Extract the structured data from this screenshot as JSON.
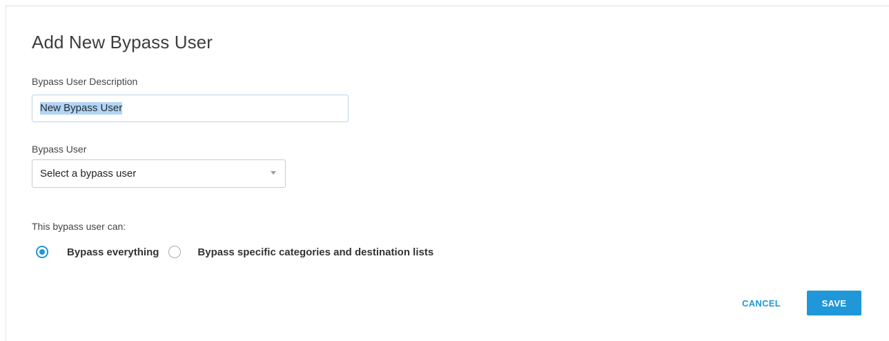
{
  "dialog": {
    "title": "Add New Bypass User"
  },
  "description_field": {
    "label": "Bypass User Description",
    "value": "New Bypass User"
  },
  "bypass_user_field": {
    "label": "Bypass User",
    "selected": "Select a bypass user"
  },
  "permissions": {
    "label": "This bypass user can:",
    "options": [
      {
        "label": "Bypass everything",
        "selected": true
      },
      {
        "label": "Bypass specific categories and destination lists",
        "selected": false
      }
    ]
  },
  "actions": {
    "cancel_label": "CANCEL",
    "save_label": "SAVE"
  },
  "colors": {
    "accent": "#1f97d8",
    "selection_highlight": "#b3d4f4"
  }
}
